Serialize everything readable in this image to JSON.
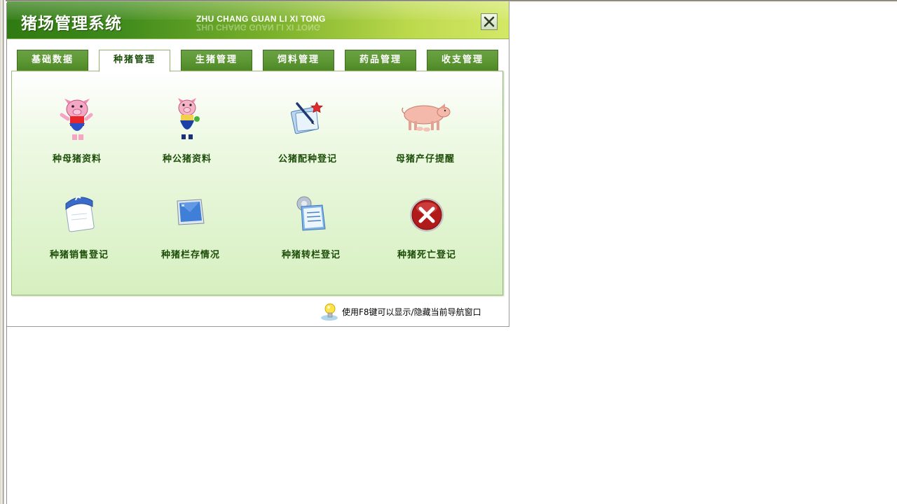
{
  "window": {
    "title": "猪场管理系统",
    "subtitle": "ZHU CHANG GUAN LI XI TONG"
  },
  "tabs": [
    {
      "label": "基础数据",
      "active": false
    },
    {
      "label": "种猪管理",
      "active": true
    },
    {
      "label": "生猪管理",
      "active": false
    },
    {
      "label": "饲料管理",
      "active": false
    },
    {
      "label": "药品管理",
      "active": false
    },
    {
      "label": "收支管理",
      "active": false
    }
  ],
  "items": [
    {
      "label": "种母猪资料",
      "icon": "sow-cartoon-icon"
    },
    {
      "label": "种公猪资料",
      "icon": "boar-cartoon-icon"
    },
    {
      "label": "公猪配种登记",
      "icon": "edit-document-icon"
    },
    {
      "label": "母猪产仔提醒",
      "icon": "sow-piglets-icon"
    },
    {
      "label": "种猪销售登记",
      "icon": "calendar-note-icon"
    },
    {
      "label": "种猪栏存情况",
      "icon": "monitor-icon"
    },
    {
      "label": "种猪转栏登记",
      "icon": "clipboard-gear-icon"
    },
    {
      "label": "种猪死亡登记",
      "icon": "red-x-icon"
    }
  ],
  "hint": {
    "text": "使用F8键可以显示/隐藏当前导航窗口",
    "icon": "lightbulb-icon"
  },
  "colors": {
    "header_dark": "#2f7a12",
    "header_light": "#d4e866",
    "tab": "#5f9a36",
    "label": "#1c4d08"
  }
}
